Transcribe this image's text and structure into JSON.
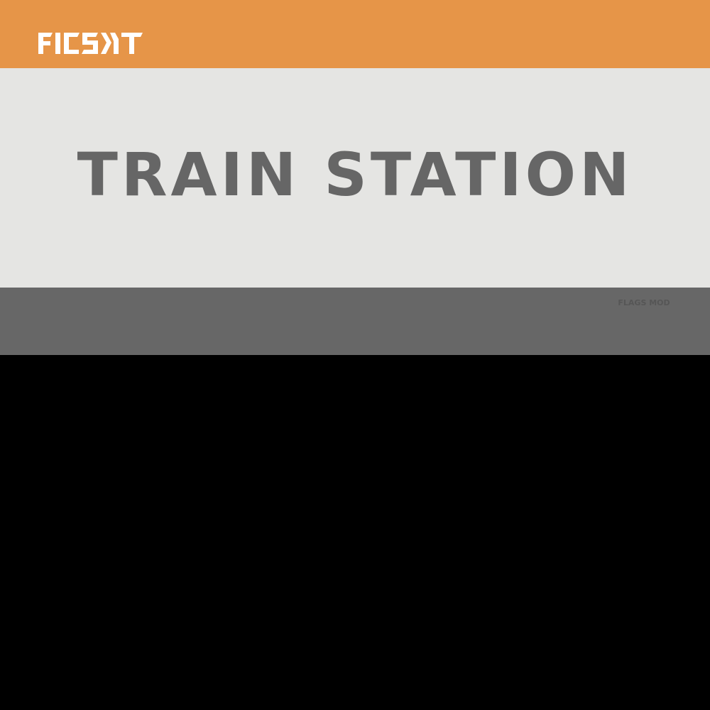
{
  "brand": {
    "logo_text": "FICSIT"
  },
  "sign": {
    "title": "TRAIN STATION",
    "footer_label": "FLAGS MOD"
  },
  "colors": {
    "top_band": "#e69548",
    "title_band": "#e5e5e3",
    "title_text": "#666666",
    "footer_band": "#676767",
    "footer_text": "#565656",
    "bottom_band": "#000000",
    "logo": "#ffffff"
  }
}
